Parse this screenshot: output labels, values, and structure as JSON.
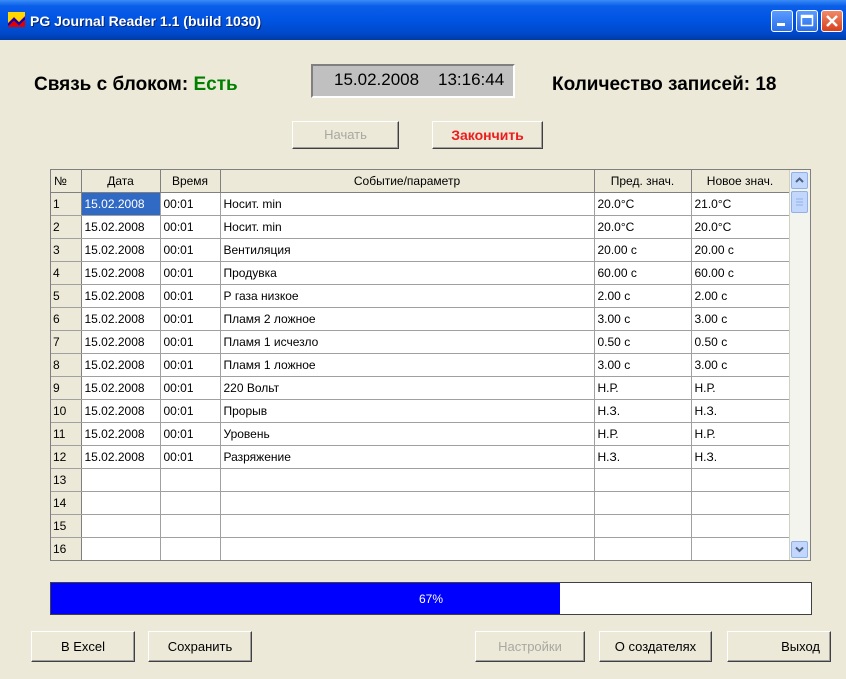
{
  "window": {
    "title": "PG Journal Reader 1.1 (build 1030)"
  },
  "status": {
    "connection_label": "Связь с блоком:",
    "connection_value": "Есть",
    "date": "15.02.2008",
    "time": "13:16:44",
    "count_label": "Количество записей:",
    "count_value": "18"
  },
  "buttons": {
    "start": "Начать",
    "finish": "Закончить",
    "excel": "В Excel",
    "save": "Сохранить",
    "settings": "Настройки",
    "about": "О создателях",
    "exit": "Выход"
  },
  "table": {
    "headers": [
      "№",
      "Дата",
      "Время",
      "Событие/параметр",
      "Пред. знач.",
      "Новое знач."
    ],
    "rows": [
      [
        "1",
        "15.02.2008",
        "00:01",
        "Носит. min",
        "20.0°C",
        "21.0°C"
      ],
      [
        "2",
        "15.02.2008",
        "00:01",
        "Носит. min",
        "20.0°C",
        "20.0°C"
      ],
      [
        "3",
        "15.02.2008",
        "00:01",
        "Вентиляция",
        "20.00 с",
        "20.00 с"
      ],
      [
        "4",
        "15.02.2008",
        "00:01",
        "Продувка",
        "60.00 с",
        "60.00 с"
      ],
      [
        "5",
        "15.02.2008",
        "00:01",
        "Р газа низкое",
        "2.00 с",
        "2.00 с"
      ],
      [
        "6",
        "15.02.2008",
        "00:01",
        "Пламя 2 ложное",
        "3.00 с",
        "3.00 с"
      ],
      [
        "7",
        "15.02.2008",
        "00:01",
        "Пламя 1 исчезло",
        "0.50 с",
        "0.50 с"
      ],
      [
        "8",
        "15.02.2008",
        "00:01",
        "Пламя 1 ложное",
        "3.00 с",
        "3.00 с"
      ],
      [
        "9",
        "15.02.2008",
        "00:01",
        "220 Вольт",
        "Н.Р.",
        "Н.Р."
      ],
      [
        "10",
        "15.02.2008",
        "00:01",
        "Прорыв",
        "Н.З.",
        "Н.З."
      ],
      [
        "11",
        "15.02.2008",
        "00:01",
        "Уровень",
        "Н.Р.",
        "Н.Р."
      ],
      [
        "12",
        "15.02.2008",
        "00:01",
        "Разряжение",
        "Н.З.",
        "Н.З."
      ],
      [
        "13",
        "",
        "",
        "",
        "",
        ""
      ],
      [
        "14",
        "",
        "",
        "",
        "",
        ""
      ],
      [
        "15",
        "",
        "",
        "",
        "",
        ""
      ],
      [
        "16",
        "",
        "",
        "",
        "",
        ""
      ]
    ]
  },
  "progress": {
    "value": 0.67,
    "label": "67%"
  },
  "colors": {
    "connection_ok": "#008000",
    "finish_button": "#ee1c1c",
    "progress_fill": "#0000ff",
    "selection": "#316ac5"
  }
}
